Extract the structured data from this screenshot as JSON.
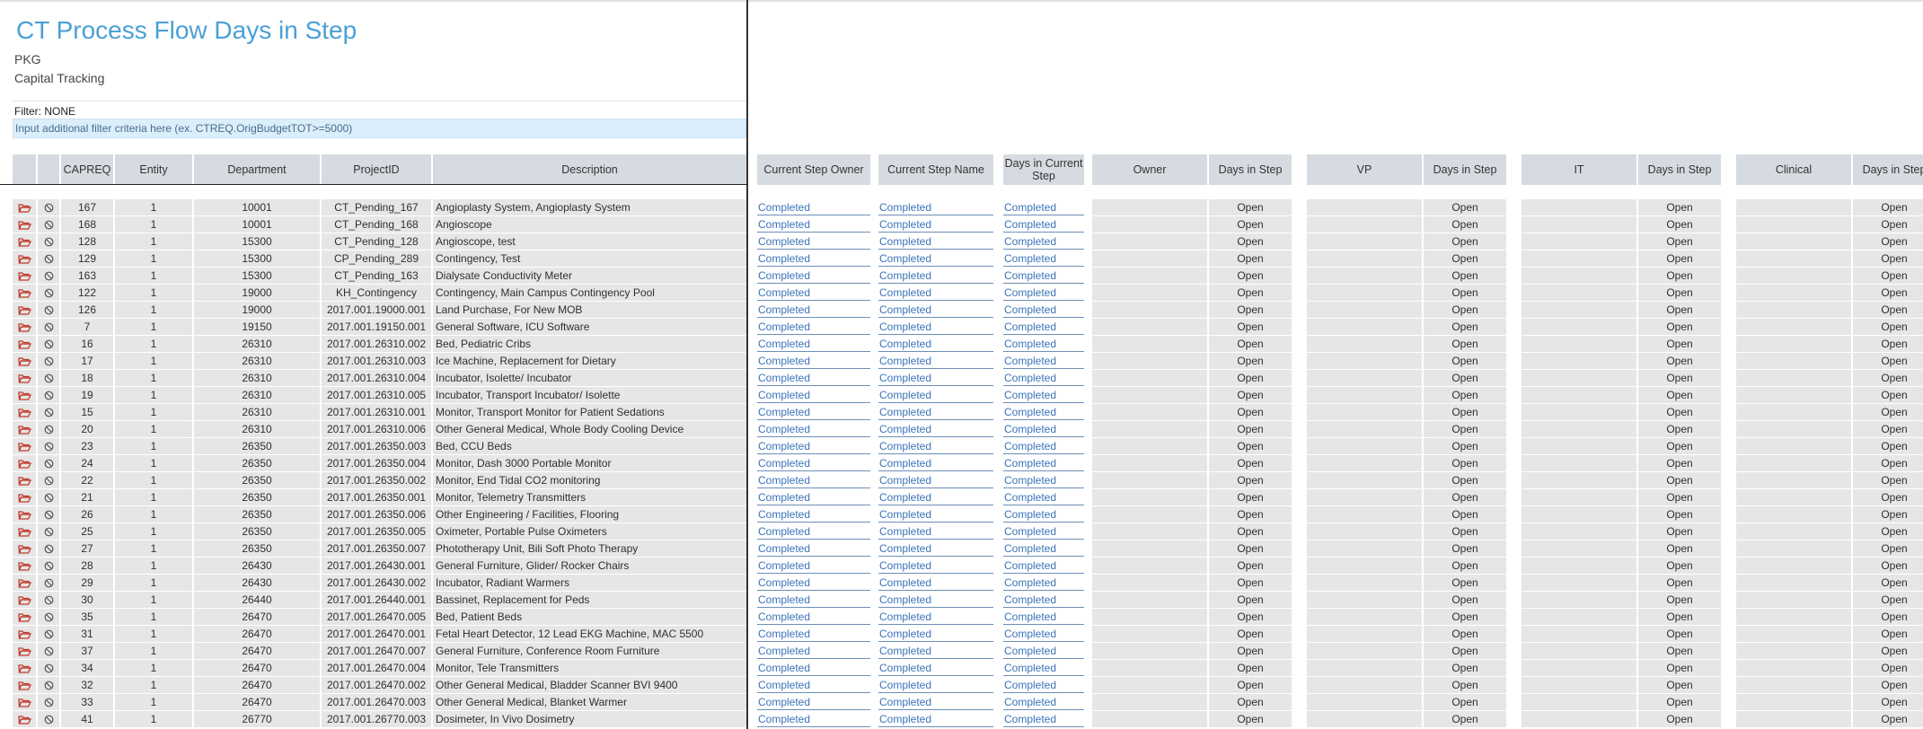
{
  "header": {
    "title": "CT Process Flow Days in Step",
    "subtitle1": "PKG",
    "subtitle2": "Capital Tracking",
    "filter_label": "Filter: NONE",
    "filter_placeholder": "Input additional filter criteria here (ex. CTREQ.OrigBudgetTOT>=5000)"
  },
  "columns": {
    "capreq": "CAPREQ",
    "entity": "Entity",
    "department": "Department",
    "project_id": "ProjectID",
    "description": "Description",
    "current_step_owner": "Current Step Owner",
    "current_step_name": "Current Step Name",
    "days_current_step": "Days in Current Step",
    "owner": "Owner",
    "days_owner": "Days in Step",
    "vp": "VP",
    "days_vp": "Days in Step",
    "it": "IT",
    "days_it": "Days in Step",
    "clinical": "Clinical",
    "days_clinical": "Days in Step"
  },
  "status_text": {
    "completed": "Completed",
    "open": "Open"
  },
  "icons": {
    "open_record": "folder-open-icon",
    "cancel": "cancel-icon"
  },
  "colors": {
    "title": "#4aa0d6",
    "header_bg": "#d6dbe1",
    "filter_bg": "#dbeefb",
    "completed_link": "#3b73b9",
    "folder_icon": "#c0392b"
  },
  "rows": [
    {
      "capreq": "167",
      "entity": "1",
      "dept": "10001",
      "project": "CT_Pending_167",
      "desc": "Angioplasty System, Angioplasty System"
    },
    {
      "capreq": "168",
      "entity": "1",
      "dept": "10001",
      "project": "CT_Pending_168",
      "desc": "Angioscope"
    },
    {
      "capreq": "128",
      "entity": "1",
      "dept": "15300",
      "project": "CT_Pending_128",
      "desc": "Angioscope, test"
    },
    {
      "capreq": "129",
      "entity": "1",
      "dept": "15300",
      "project": "CP_Pending_289",
      "desc": "Contingency, Test"
    },
    {
      "capreq": "163",
      "entity": "1",
      "dept": "15300",
      "project": "CT_Pending_163",
      "desc": "Dialysate Conductivity Meter"
    },
    {
      "capreq": "122",
      "entity": "1",
      "dept": "19000",
      "project": "KH_Contingency",
      "desc": "Contingency, Main Campus Contingency Pool"
    },
    {
      "capreq": "126",
      "entity": "1",
      "dept": "19000",
      "project": "2017.001.19000.001",
      "desc": "Land Purchase, For New MOB"
    },
    {
      "capreq": "7",
      "entity": "1",
      "dept": "19150",
      "project": "2017.001.19150.001",
      "desc": "General Software, ICU Software"
    },
    {
      "capreq": "16",
      "entity": "1",
      "dept": "26310",
      "project": "2017.001.26310.002",
      "desc": "Bed, Pediatric Cribs"
    },
    {
      "capreq": "17",
      "entity": "1",
      "dept": "26310",
      "project": "2017.001.26310.003",
      "desc": "Ice Machine, Replacement for Dietary"
    },
    {
      "capreq": "18",
      "entity": "1",
      "dept": "26310",
      "project": "2017.001.26310.004",
      "desc": "Incubator, Isolette/ Incubator"
    },
    {
      "capreq": "19",
      "entity": "1",
      "dept": "26310",
      "project": "2017.001.26310.005",
      "desc": "Incubator, Transport Incubator/ Isolette"
    },
    {
      "capreq": "15",
      "entity": "1",
      "dept": "26310",
      "project": "2017.001.26310.001",
      "desc": "Monitor, Transport Monitor for Patient Sedations"
    },
    {
      "capreq": "20",
      "entity": "1",
      "dept": "26310",
      "project": "2017.001.26310.006",
      "desc": "Other General Medical, Whole Body Cooling Device"
    },
    {
      "capreq": "23",
      "entity": "1",
      "dept": "26350",
      "project": "2017.001.26350.003",
      "desc": "Bed, CCU Beds"
    },
    {
      "capreq": "24",
      "entity": "1",
      "dept": "26350",
      "project": "2017.001.26350.004",
      "desc": "Monitor, Dash 3000 Portable Monitor"
    },
    {
      "capreq": "22",
      "entity": "1",
      "dept": "26350",
      "project": "2017.001.26350.002",
      "desc": "Monitor, End Tidal CO2 monitoring"
    },
    {
      "capreq": "21",
      "entity": "1",
      "dept": "26350",
      "project": "2017.001.26350.001",
      "desc": "Monitor, Telemetry Transmitters"
    },
    {
      "capreq": "26",
      "entity": "1",
      "dept": "26350",
      "project": "2017.001.26350.006",
      "desc": "Other Engineering / Facilities, Flooring"
    },
    {
      "capreq": "25",
      "entity": "1",
      "dept": "26350",
      "project": "2017.001.26350.005",
      "desc": "Oximeter, Portable Pulse Oximeters"
    },
    {
      "capreq": "27",
      "entity": "1",
      "dept": "26350",
      "project": "2017.001.26350.007",
      "desc": "Phototherapy Unit, Bili Soft Photo Therapy"
    },
    {
      "capreq": "28",
      "entity": "1",
      "dept": "26430",
      "project": "2017.001.26430.001",
      "desc": "General Furniture, Glider/ Rocker Chairs"
    },
    {
      "capreq": "29",
      "entity": "1",
      "dept": "26430",
      "project": "2017.001.26430.002",
      "desc": "Incubator, Radiant Warmers"
    },
    {
      "capreq": "30",
      "entity": "1",
      "dept": "26440",
      "project": "2017.001.26440.001",
      "desc": "Bassinet, Replacement for Peds"
    },
    {
      "capreq": "35",
      "entity": "1",
      "dept": "26470",
      "project": "2017.001.26470.005",
      "desc": "Bed, Patient Beds"
    },
    {
      "capreq": "31",
      "entity": "1",
      "dept": "26470",
      "project": "2017.001.26470.001",
      "desc": "Fetal Heart Detector, 12 Lead EKG Machine, MAC 5500"
    },
    {
      "capreq": "37",
      "entity": "1",
      "dept": "26470",
      "project": "2017.001.26470.007",
      "desc": "General Furniture, Conference Room Furniture"
    },
    {
      "capreq": "34",
      "entity": "1",
      "dept": "26470",
      "project": "2017.001.26470.004",
      "desc": "Monitor, Tele Transmitters"
    },
    {
      "capreq": "32",
      "entity": "1",
      "dept": "26470",
      "project": "2017.001.26470.002",
      "desc": "Other General Medical, Bladder Scanner BVI 9400"
    },
    {
      "capreq": "33",
      "entity": "1",
      "dept": "26470",
      "project": "2017.001.26470.003",
      "desc": "Other General Medical, Blanket Warmer"
    },
    {
      "capreq": "41",
      "entity": "1",
      "dept": "26770",
      "project": "2017.001.26770.003",
      "desc": "Dosimeter, In Vivo Dosimetry"
    }
  ]
}
